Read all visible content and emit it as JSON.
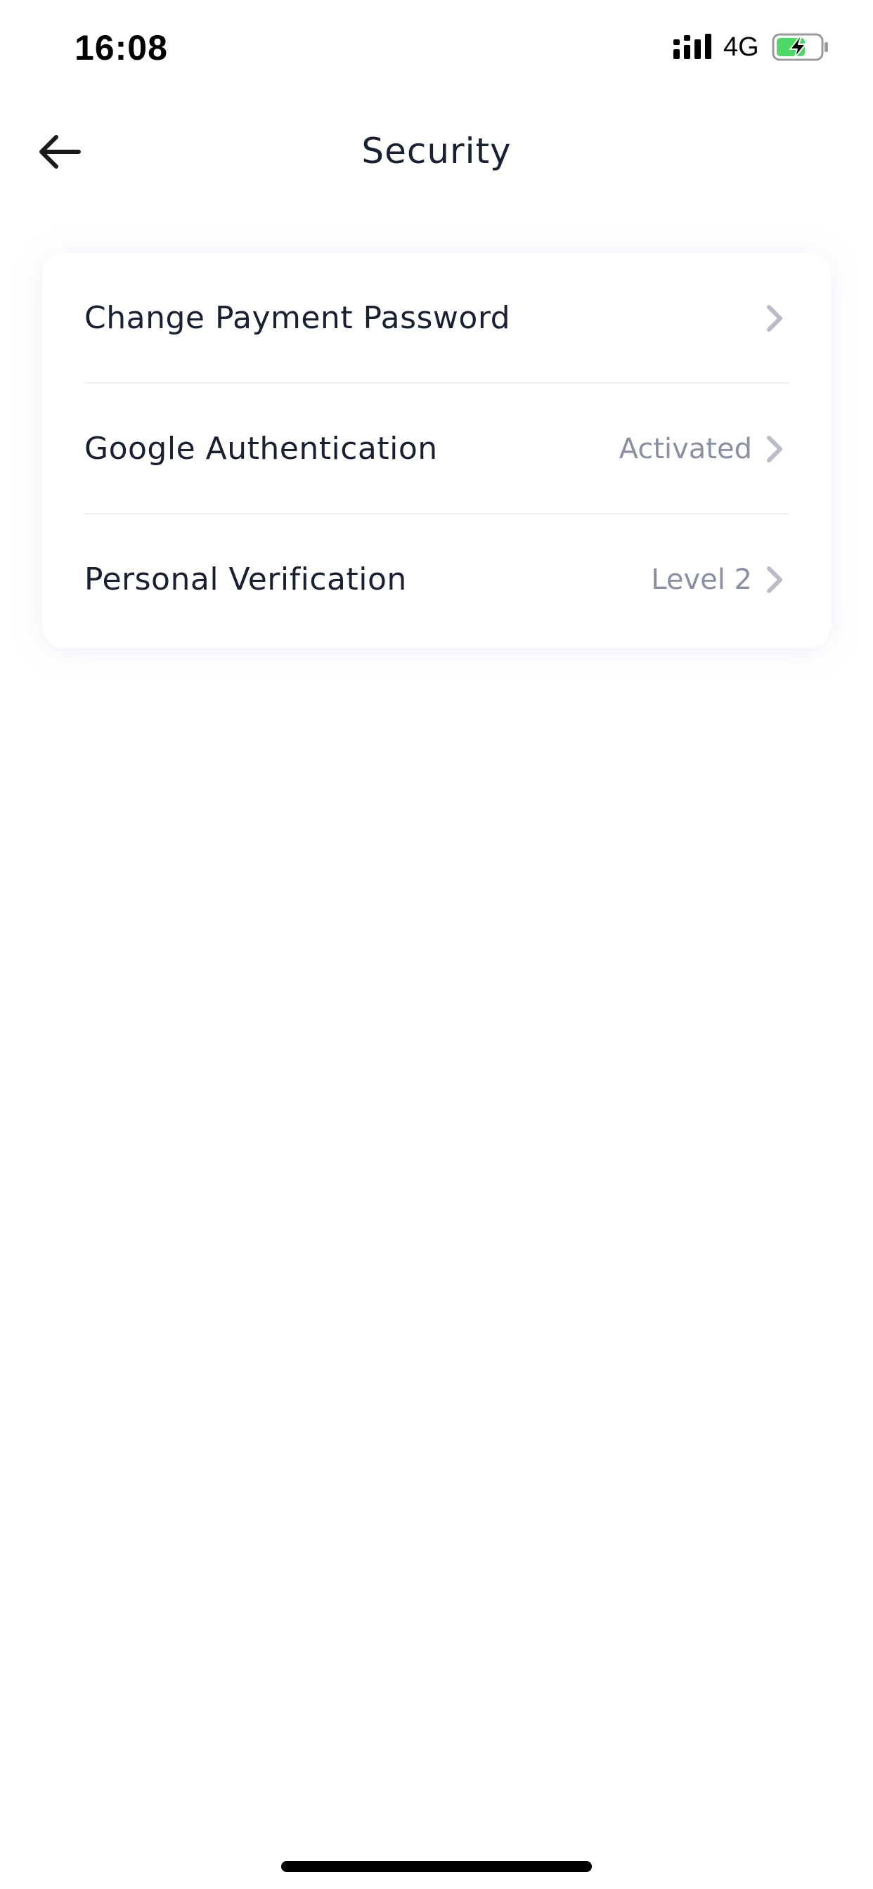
{
  "status_bar": {
    "time": "16:08",
    "network": "4G",
    "signal_icon": "signal-icon",
    "battery_icon": "battery-charging-icon",
    "battery_color": "#4cd964"
  },
  "header": {
    "back_icon": "arrow-left-icon",
    "title": "Security"
  },
  "settings": {
    "items": [
      {
        "label": "Change Payment Password",
        "value": ""
      },
      {
        "label": "Google Authentication",
        "value": "Activated"
      },
      {
        "label": "Personal Verification",
        "value": "Level 2"
      }
    ]
  },
  "colors": {
    "background": "#ffffff",
    "text_primary": "#1a2033",
    "text_secondary": "#8a90a4",
    "chevron": "#b8bcc8",
    "divider": "#edeef3"
  }
}
